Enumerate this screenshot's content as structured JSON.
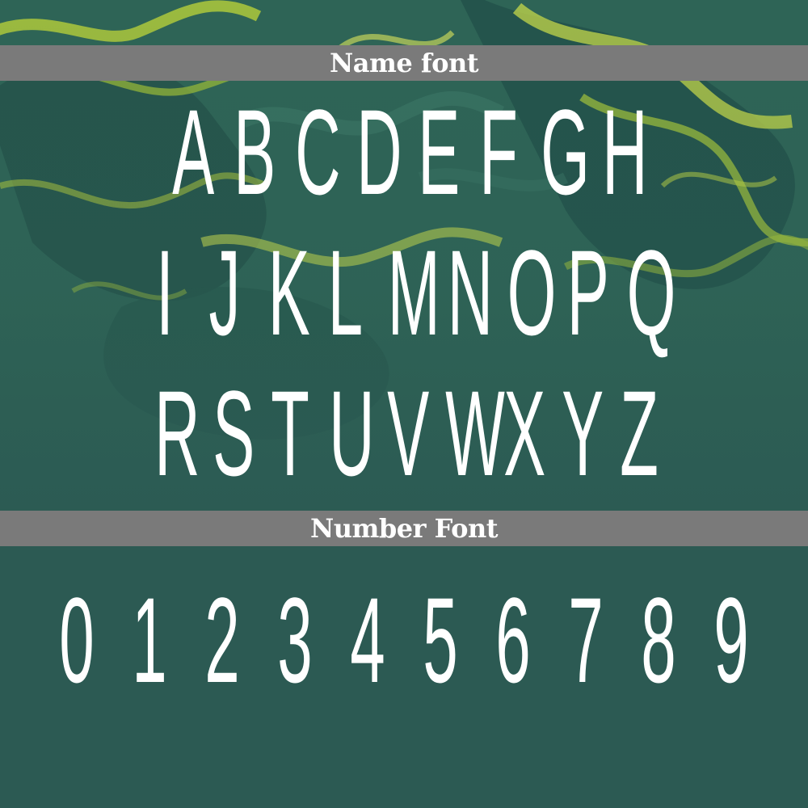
{
  "headers": {
    "name_font": "Name font",
    "number_font": "Number Font"
  },
  "letters": {
    "row1": [
      "A",
      "B",
      "C",
      "D",
      "E",
      "F",
      "G",
      "H"
    ],
    "row2": [
      "I",
      "J",
      "K",
      "L",
      "M",
      "N",
      "O",
      "P",
      "Q"
    ],
    "row3": [
      "R",
      "S",
      "T",
      "U",
      "V",
      "W",
      "X",
      "Y",
      "Z"
    ]
  },
  "digits": [
    "0",
    "1",
    "2",
    "3",
    "4",
    "5",
    "6",
    "7",
    "8",
    "9"
  ],
  "colors": {
    "background": "#2c5a53",
    "band": "#7a7a7a",
    "text": "#ffffff",
    "swirl_light": "#b7cf3a",
    "swirl_dark": "#1f4a43"
  }
}
